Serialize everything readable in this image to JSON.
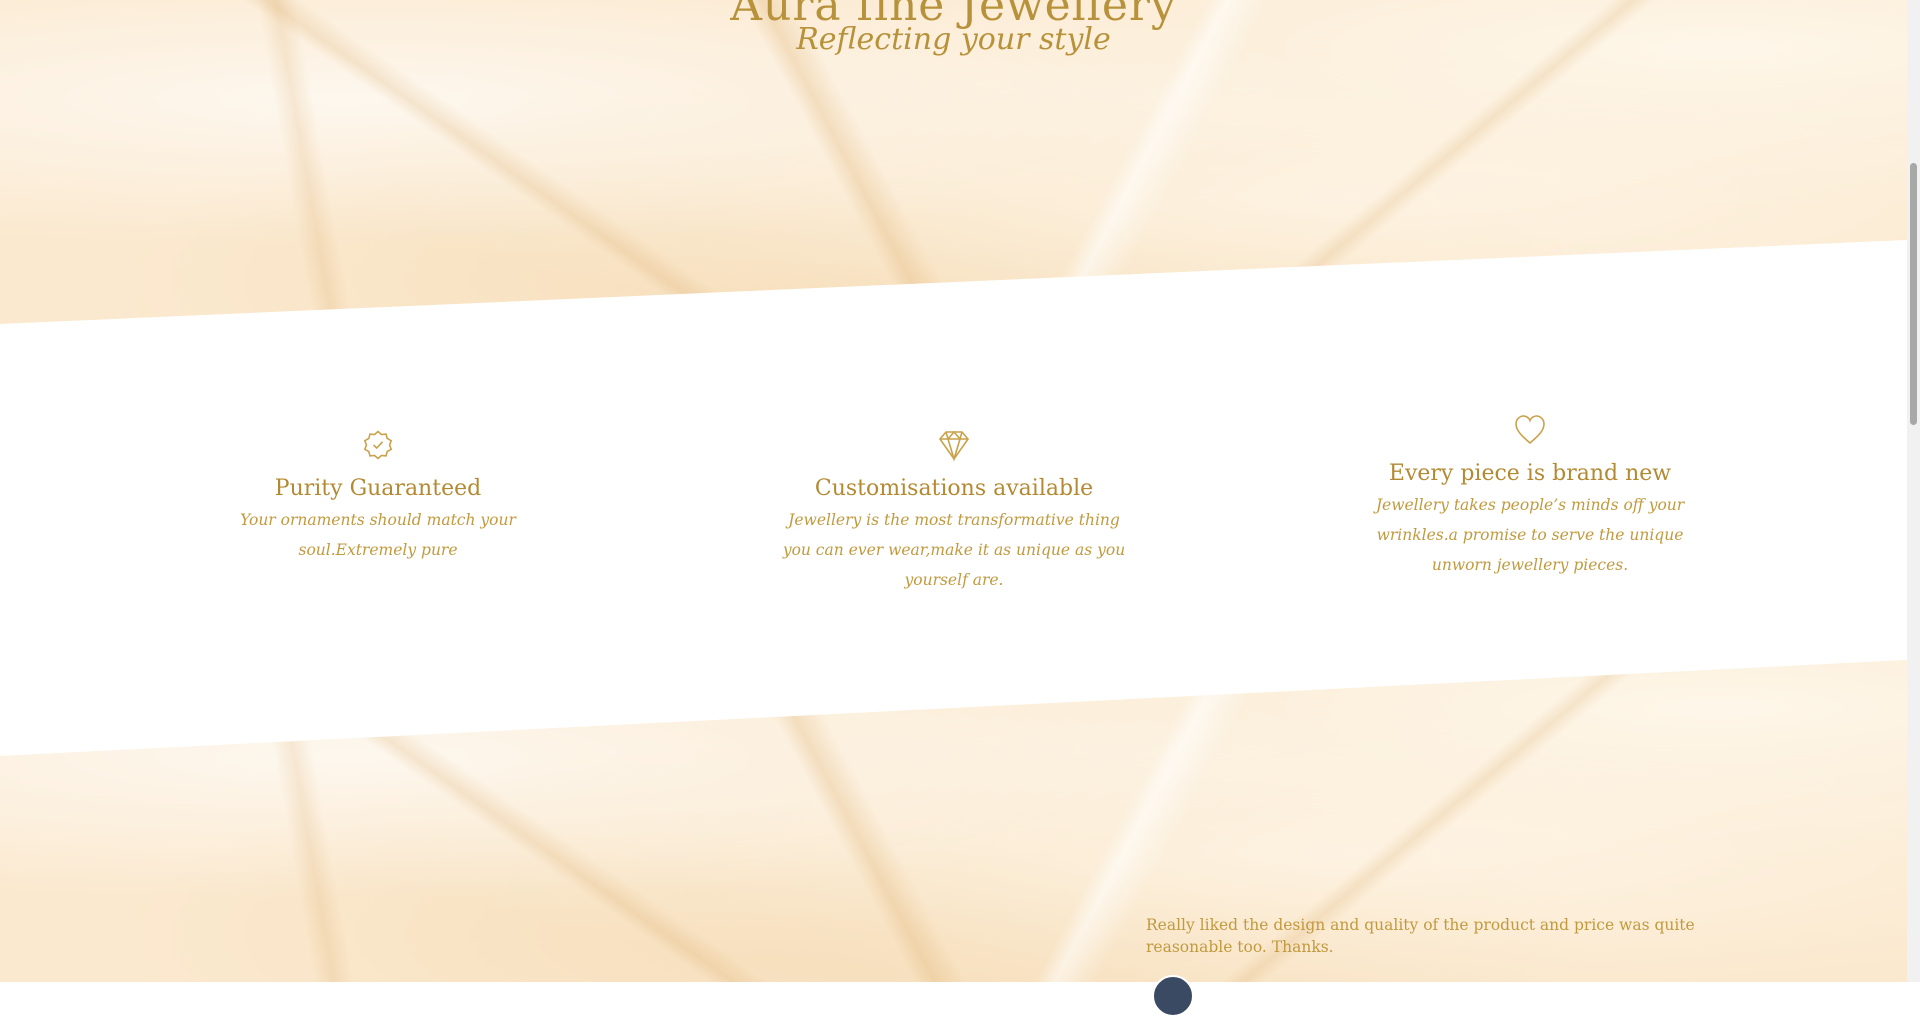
{
  "hero": {
    "title": "Aura fine Jewellery",
    "tagline": "Reflecting your style"
  },
  "features": [
    {
      "icon": "badge-check-icon",
      "title": "Purity Guaranteed",
      "description": "Your ornaments should match your soul.Extremely pure"
    },
    {
      "icon": "diamond-icon",
      "title": "Customisations available",
      "description": "Jewellery is the most transformative thing you can ever wear,make it as unique as you yourself are."
    },
    {
      "icon": "heart-icon",
      "title": "Every piece is brand new",
      "description": "Jewellery takes people’s minds off your wrinkles.a promise to serve the unique unworn jewellery pieces."
    }
  ],
  "testimonial": {
    "text": "Really liked the design and quality of the product and price was quite reasonable too. Thanks."
  },
  "colors": {
    "accent": "#b8923a",
    "marble": "#fbe9cf",
    "background": "#ffffff"
  }
}
